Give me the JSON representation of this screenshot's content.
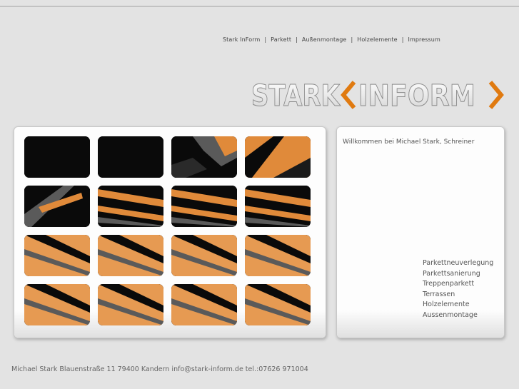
{
  "nav": {
    "items": [
      "Stark InForm",
      "Parkett",
      "Außenmontage",
      "Holzelemente",
      "Impressum"
    ],
    "separator": "|"
  },
  "logo": {
    "text": "STARKINFORM",
    "brand_color": "#e07a10",
    "alt_label": "STARK INFORM"
  },
  "gallery": {
    "tiles": [
      {
        "pattern": "black"
      },
      {
        "pattern": "black"
      },
      {
        "pattern": "dark-orange-corner"
      },
      {
        "pattern": "orange-dark"
      },
      {
        "pattern": "dark-orange-stripe"
      },
      {
        "pattern": "orange-stripes"
      },
      {
        "pattern": "orange-stripes"
      },
      {
        "pattern": "orange-stripes"
      },
      {
        "pattern": "light-orange-diagonal"
      },
      {
        "pattern": "light-orange-diagonal"
      },
      {
        "pattern": "light-orange-diagonal"
      },
      {
        "pattern": "light-orange-diagonal"
      },
      {
        "pattern": "light-orange-diagonal"
      },
      {
        "pattern": "light-orange-diagonal"
      },
      {
        "pattern": "light-orange-diagonal"
      },
      {
        "pattern": "light-orange-diagonal"
      }
    ]
  },
  "content": {
    "welcome": "Willkommen bei Michael Stark, Schreiner",
    "menu": [
      "Parkettneuverlegung",
      "Parkettsanierung",
      "Treppenparkett",
      "Terrassen",
      "Holzelemente",
      "Aussenmontage"
    ]
  },
  "footer": {
    "text": "Michael Stark Blauenstraße 11 79400 Kandern info@stark-inform.de tel.:07626 971004"
  },
  "colors": {
    "background": "#e3e3e3",
    "orange": "#e08a3a",
    "dark": "#0a0a0a"
  }
}
